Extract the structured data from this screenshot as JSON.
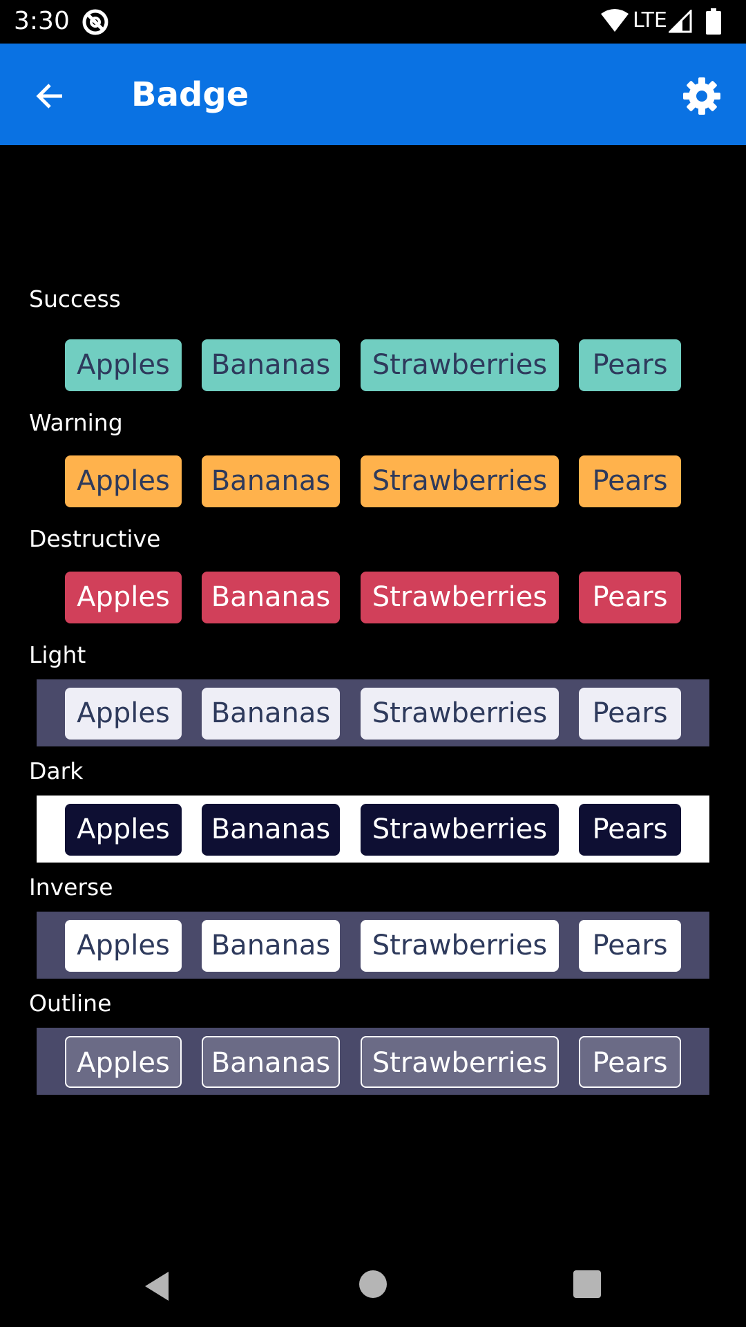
{
  "status_bar": {
    "time": "3:30",
    "network": "LTE",
    "icons": [
      "app-notification-icon",
      "wifi-icon",
      "signal-icon",
      "battery-icon"
    ]
  },
  "app_bar": {
    "title": "Badge",
    "back_icon": "arrow-left-icon",
    "settings_icon": "gear-icon",
    "color": "#0a72e3"
  },
  "sections": [
    {
      "label": "Success",
      "background": null,
      "badge_bg": "#71cec1",
      "badge_text": "#2e3a5c",
      "badge_border": null,
      "badges": [
        "Apples",
        "Bananas",
        "Strawberries",
        "Pears"
      ]
    },
    {
      "label": "Warning",
      "background": null,
      "badge_bg": "#ffb24c",
      "badge_text": "#2e3a5c",
      "badge_border": null,
      "badges": [
        "Apples",
        "Bananas",
        "Strawberries",
        "Pears"
      ]
    },
    {
      "label": "Destructive",
      "background": null,
      "badge_bg": "#d1405a",
      "badge_text": "#ffffff",
      "badge_border": null,
      "badges": [
        "Apples",
        "Bananas",
        "Strawberries",
        "Pears"
      ]
    },
    {
      "label": "Light",
      "background": "#4a4a6a",
      "badge_bg": "#eeeef6",
      "badge_text": "#2e3a5c",
      "badge_border": null,
      "badges": [
        "Apples",
        "Bananas",
        "Strawberries",
        "Pears"
      ]
    },
    {
      "label": "Dark",
      "background": "#ffffff",
      "badge_bg": "#0e0f33",
      "badge_text": "#ffffff",
      "badge_border": null,
      "badges": [
        "Apples",
        "Bananas",
        "Strawberries",
        "Pears"
      ]
    },
    {
      "label": "Inverse",
      "background": "#4a4a6a",
      "badge_bg": "#ffffff",
      "badge_text": "#2e3a5c",
      "badge_border": null,
      "badges": [
        "Apples",
        "Bananas",
        "Strawberries",
        "Pears"
      ]
    },
    {
      "label": "Outline",
      "background": "#4a4a6a",
      "badge_bg": "#6b6b86",
      "badge_text": "#ffffff",
      "badge_border": "#ffffff",
      "badges": [
        "Apples",
        "Bananas",
        "Strawberries",
        "Pears"
      ]
    }
  ],
  "nav_bar": {
    "icons": [
      "nav-back-icon",
      "nav-home-icon",
      "nav-recents-icon"
    ]
  }
}
